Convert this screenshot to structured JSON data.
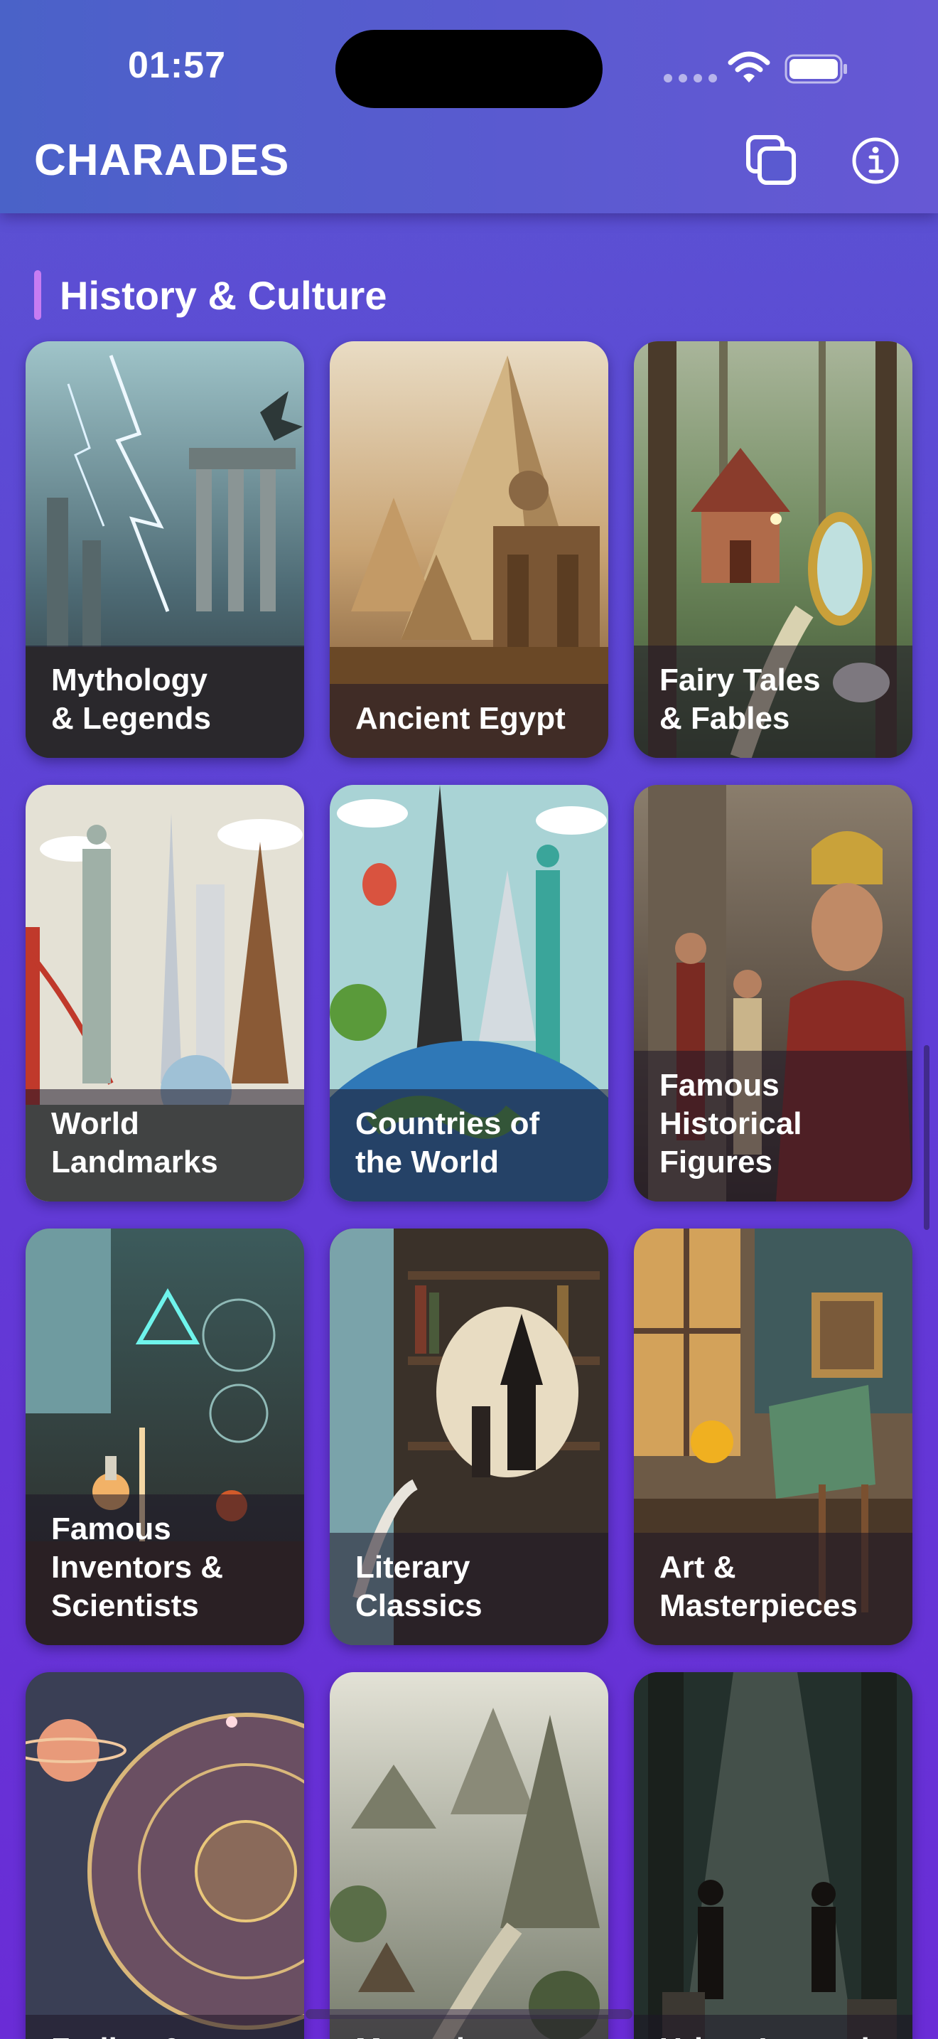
{
  "status_bar": {
    "time": "01:57"
  },
  "header": {
    "title": "CHARADES",
    "copy_icon": "copy-icon",
    "info_icon": "info-icon"
  },
  "section": {
    "title": "History & Culture"
  },
  "cards": [
    {
      "label": "Mythology\n& Legends"
    },
    {
      "label": "Ancient Egypt"
    },
    {
      "label": "Fairy Tales\n& Fables"
    },
    {
      "label": "World\nLandmarks"
    },
    {
      "label": "Countries of\nthe World"
    },
    {
      "label": "Famous\nHistorical\nFigures"
    },
    {
      "label": "Famous\nInventors &\nScientists"
    },
    {
      "label": "Literary\nClassics"
    },
    {
      "label": "Art &\nMasterpieces"
    },
    {
      "label": "Zodiac &"
    },
    {
      "label": "Mysterious"
    },
    {
      "label": "Urban Legends"
    }
  ]
}
